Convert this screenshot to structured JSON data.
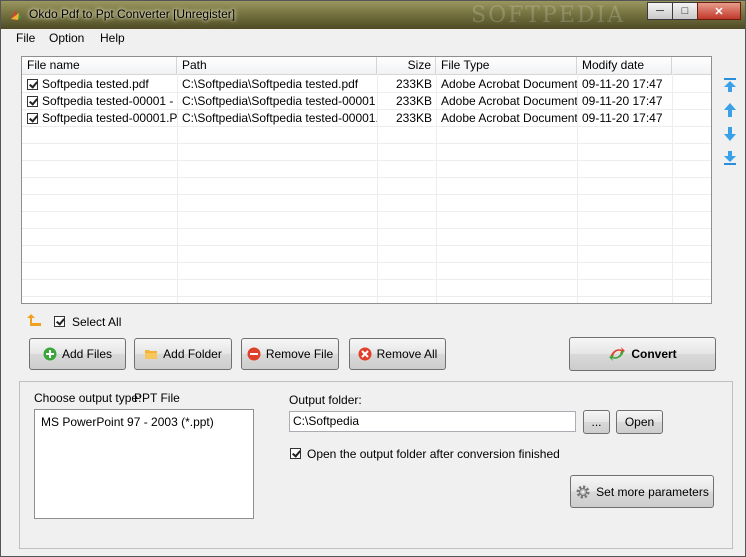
{
  "window": {
    "title": "Okdo Pdf to Ppt Converter [Unregister]",
    "watermark": "SOFTPEDIA",
    "controls": {
      "minimize": "─",
      "maximize": "□",
      "close": "✕"
    }
  },
  "menu": [
    "File",
    "Option",
    "Help"
  ],
  "file_list": {
    "columns": [
      "File name",
      "Path",
      "Size",
      "File Type",
      "Modify date"
    ],
    "rows": [
      {
        "checked": true,
        "name": "Softpedia tested.pdf",
        "path": "C:\\Softpedia\\Softpedia tested.pdf",
        "size": "233KB",
        "type": "Adobe Acrobat Document",
        "date": "09-11-20 17:47"
      },
      {
        "checked": true,
        "name": "Softpedia tested-00001 - ...",
        "path": "C:\\Softpedia\\Softpedia tested-00001 ...",
        "size": "233KB",
        "type": "Adobe Acrobat Document",
        "date": "09-11-20 17:47"
      },
      {
        "checked": true,
        "name": "Softpedia tested-00001.P...",
        "path": "C:\\Softpedia\\Softpedia tested-00001....",
        "size": "233KB",
        "type": "Adobe Acrobat Document",
        "date": "09-11-20 17:47"
      }
    ]
  },
  "select_all": {
    "label": "Select All",
    "checked": true
  },
  "buttons": {
    "add_files": "Add Files",
    "add_folder": "Add Folder",
    "remove_file": "Remove File",
    "remove_all": "Remove All",
    "convert": "Convert"
  },
  "output": {
    "type_label": "Choose output type:",
    "type_value": "PPT File",
    "type_options": [
      "MS PowerPoint 97 - 2003 (*.ppt)"
    ],
    "folder_label": "Output folder:",
    "folder_value": "C:\\Softpedia",
    "browse_label": "...",
    "open_label": "Open",
    "open_after": {
      "label": "Open the output folder after conversion finished",
      "checked": true
    },
    "more_params": "Set more parameters"
  }
}
